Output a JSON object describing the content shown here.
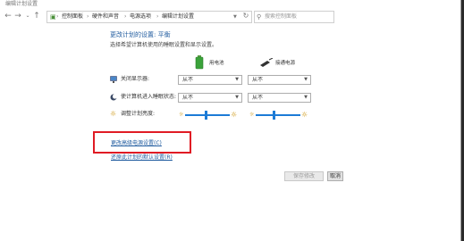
{
  "window": {
    "title": "编辑计划设置"
  },
  "address": {
    "crumbs": [
      "控制面板",
      "硬件和声音",
      "电源选项",
      "编辑计划设置"
    ]
  },
  "search": {
    "placeholder": "搜索控制面板"
  },
  "main": {
    "heading": "更改计划的设置: 平衡",
    "subheading": "选择希望计算机使用的睡眠设置和显示设置。",
    "columns": {
      "battery": "用电池",
      "plugged": "接通电源"
    },
    "rows": [
      {
        "label": "关闭显示器:",
        "battery": "从不",
        "plugged": "从不"
      },
      {
        "label": "使计算机进入睡眠状态:",
        "battery": "从不",
        "plugged": "从不"
      },
      {
        "label": "调整计划亮度:"
      }
    ],
    "brightness": {
      "battery": 0.45,
      "plugged": 0.4
    },
    "links": {
      "advanced": "更改高级电源设置(C)",
      "restore": "还原此计划的默认设置(R)"
    },
    "buttons": {
      "save": "保存修改",
      "cancel": "取消"
    }
  },
  "colors": {
    "accent": "#1c7bd6",
    "highlight_box": "#e01b24",
    "link": "#1e5a9e"
  }
}
